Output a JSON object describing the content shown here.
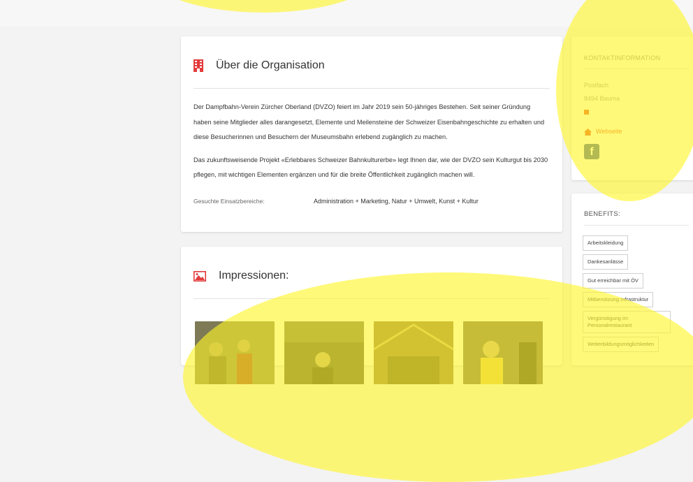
{
  "org": {
    "title": "Über die Organisation",
    "paragraph1": "Der Dampfbahn-Verein Zürcher Oberland (DVZO) feiert im Jahr 2019 sein 50-jähriges Bestehen. Seit seiner Gründung haben seine Mitglieder alles darangesetzt, Elemente und Meilensteine der Schweizer Eisenbahngeschichte zu erhalten und diese Besucherinnen und Besuchern der Museumsbahn erlebend zugänglich zu machen.",
    "paragraph2": "Das zukunftsweisende Projekt «Erlebbares Schweizer Bahnkulturerbe» legt Ihnen dar, wie der DVZO sein Kulturgut bis 2030 pflegen, mit wichtigen Elementen ergänzen und für die breite Öffentlichkeit zugänglich machen will.",
    "sought_label": "Gesuchte Einsatzbereiche:",
    "sought_value": "Administration + Marketing, Natur + Umwelt, Kunst + Kultur"
  },
  "impressions": {
    "title": "Impressionen:"
  },
  "contact": {
    "title": "KONTAKTINFORMATION",
    "line1": "Postfach",
    "line2": "8494 Bauma",
    "website_label": "Webseite",
    "facebook_glyph": "f"
  },
  "benefits": {
    "title": "BENEFITS:",
    "items": [
      "Arbeitskleidung",
      "Dankesanlässe",
      "Gut erreichbar mit ÖV",
      "Mitbenützung Infrastruktur",
      "Vergünstigung im Personalrestaurant",
      "Weiterbildungsmöglichkeiten"
    ]
  },
  "colors": {
    "accent": "#e84a1f",
    "facebook": "#3b5998",
    "highlight": "#fff528"
  }
}
